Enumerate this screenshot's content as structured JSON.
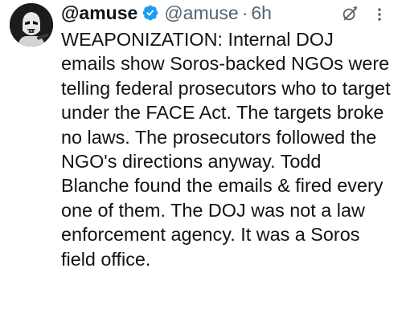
{
  "tweet": {
    "display_name": "@amuse",
    "handle": "@amuse",
    "separator": "·",
    "time": "6h",
    "body": "WEAPONIZATION: Internal DOJ emails show Soros-backed NGOs were telling federal prosecutors who to target under the FACE Act. The targets broke no laws. The prosecutors followed the NGO's directions anyway. Todd Blanche found the emails & fired every one of them. The DOJ was not a law enforcement agency. It was a Soros field office."
  },
  "icons": {
    "avatar": "stormtrooper-avatar",
    "verified": "verified-badge-icon",
    "grok": "grok-icon",
    "more": "more-options-icon"
  },
  "colors": {
    "text": "#0f1419",
    "secondary": "#536471",
    "verified": "#1d9bf0",
    "background": "#ffffff"
  }
}
